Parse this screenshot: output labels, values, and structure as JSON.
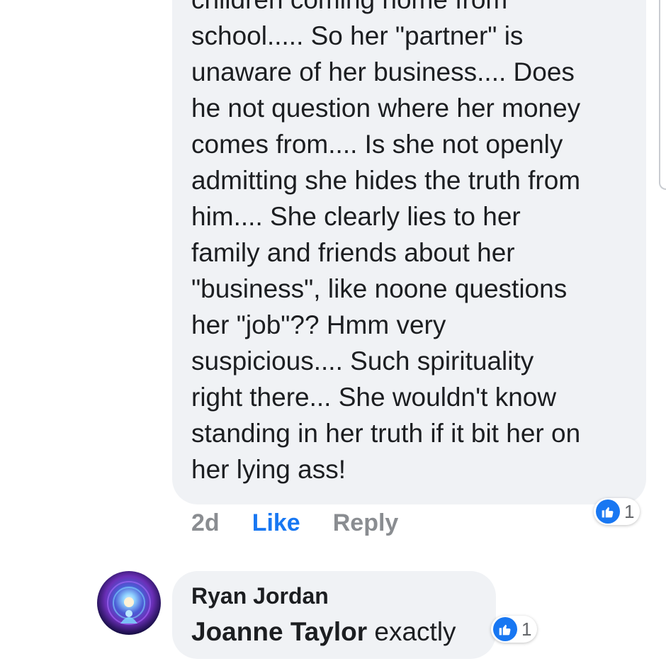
{
  "comment_1": {
    "text": "children coming home from\nschool..... So her \"partner\" is\nunaware of her business.... Does\nhe not question where her money\ncomes from.... Is she not openly\nadmitting she hides the truth from\nhim.... She clearly lies to her\nfamily and friends about her\n\"business\", like noone questions\nher \"job\"??  Hmm very\nsuspicious.... Such spirituality\nright there... She wouldn't know\nstanding in her truth if it bit her on\nher lying ass!",
    "time": "2d",
    "like_label": "Like",
    "reply_label": "Reply",
    "reaction_count": "1",
    "reaction_icon": "thumbs-up-icon"
  },
  "comment_2": {
    "author": "Ryan Jordan",
    "mention": "Joanne Taylor",
    "text": " exactly",
    "reaction_count": "1",
    "reaction_icon": "thumbs-up-icon"
  },
  "colors": {
    "bubble": "#f0f2f5",
    "accent": "#1877f2",
    "muted": "#8a8d91",
    "text": "#1c1e21"
  }
}
